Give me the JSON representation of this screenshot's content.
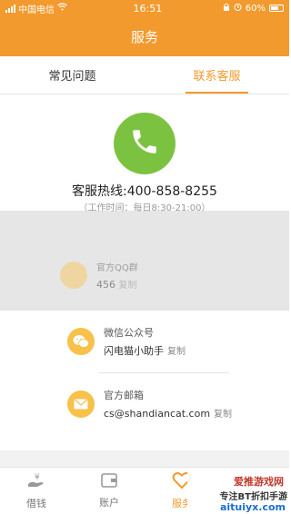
{
  "status_bar": {
    "carrier": "中国电信",
    "time": "16:51",
    "battery": "60%"
  },
  "header": {
    "title": "服务"
  },
  "tabs": [
    {
      "label": "常见问题",
      "active": false
    },
    {
      "label": "联系客服",
      "active": true
    }
  ],
  "hotline": {
    "text": "客服热线:400-858-8255",
    "hours": "（工作时间：每日8:30-21:00）"
  },
  "obscured_item": {
    "label": "官方QQ群",
    "value": "456",
    "copy": "复制"
  },
  "contacts": [
    {
      "icon": "wechat-icon",
      "label": "微信公众号",
      "value": "闪电猫小助手",
      "copy": "复制"
    },
    {
      "icon": "mail-icon",
      "label": "官方邮箱",
      "value": "cs@shandiancat.com",
      "copy": "复制"
    }
  ],
  "bottom_nav": [
    {
      "label": "借钱",
      "icon": "loan-icon",
      "active": false
    },
    {
      "label": "账户",
      "icon": "wallet-icon",
      "active": false
    },
    {
      "label": "服务",
      "icon": "heart-icon",
      "active": true
    }
  ],
  "watermark": {
    "line1": "爱推游戏网",
    "line2": "专注BT折扣手游",
    "line3": "aituiyx.com"
  },
  "colors": {
    "accent": "#f39a2e",
    "phone_green": "#7cc241",
    "icon_yellow": "#f7c14a"
  }
}
